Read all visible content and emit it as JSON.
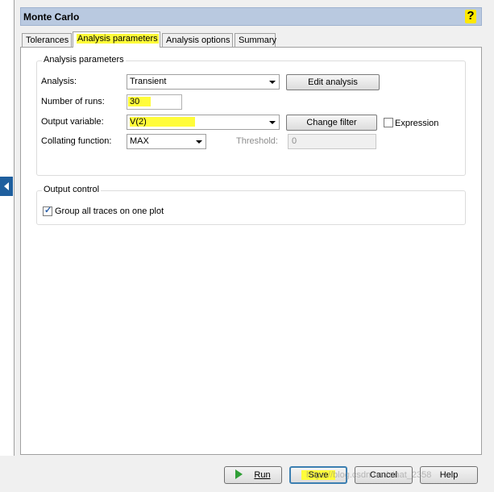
{
  "window": {
    "title": "Monte Carlo"
  },
  "tabs": [
    "Tolerances",
    "Analysis parameters",
    "Analysis options",
    "Summary"
  ],
  "analysis_group": {
    "title": "Analysis parameters",
    "analysis_label": "Analysis:",
    "analysis_value": "Transient",
    "edit_analysis_button": "Edit analysis",
    "runs_label": "Number of runs:",
    "runs_value": "30",
    "output_label": "Output variable:",
    "output_value": "V(2)",
    "change_filter_button": "Change filter",
    "expression_label": "Expression",
    "collating_label": "Collating function:",
    "collating_value": "MAX",
    "threshold_label": "Threshold:",
    "threshold_value": "0"
  },
  "output_group": {
    "title": "Output control",
    "group_traces_label": "Group all traces on one plot",
    "group_traces_checked": true
  },
  "footer": {
    "run_label": "Run",
    "save_label": "Save",
    "cancel_label": "Cancel",
    "help_label": "Help"
  },
  "watermark": "https://blog.csdn.net/sinat_2358",
  "colors": {
    "highlight": "#fffc3a",
    "titlebar": "#b9c9e0"
  }
}
